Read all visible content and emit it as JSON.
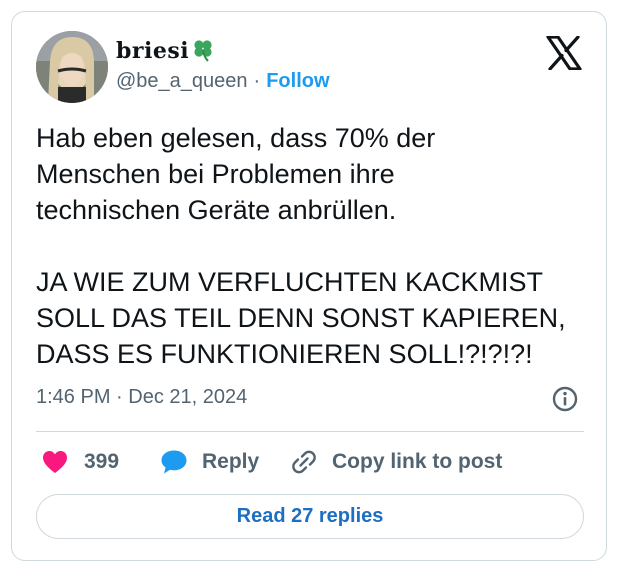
{
  "author": {
    "display_name": "briesi",
    "badge_icon": "four-leaf-clover-icon",
    "handle": "@be_a_queen",
    "separator": "·",
    "follow_label": "Follow"
  },
  "platform_icon": "x-logo-icon",
  "tweet": {
    "text": "Hab eben gelesen, dass 70% der\nMenschen bei Problemen ihre\ntechnischen Geräte anbrüllen.\n\nJA WIE ZUM VERFLUCHTEN KACKMIST\nSOLL DAS TEIL DENN SONST KAPIEREN,\nDASS ES FUNKTIONIEREN SOLL!?!?!?!",
    "timestamp": "1:46 PM · Dec 21, 2024"
  },
  "actions": {
    "likes": "399",
    "reply_label": "Reply",
    "copy_label": "Copy link to post"
  },
  "read_replies_label": "Read 27 replies",
  "colors": {
    "accent": "#1d9bf0",
    "like": "#f91880",
    "reply": "#1d9bf0",
    "clover": "#3ba55d",
    "text": "#0f1419",
    "muted": "#536471",
    "border": "#cfd9de"
  }
}
